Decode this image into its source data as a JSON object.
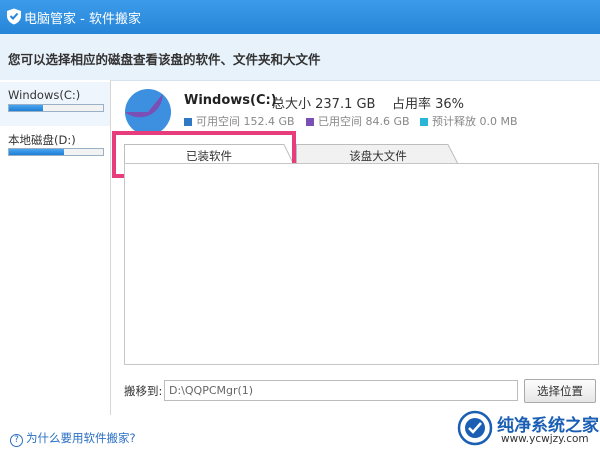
{
  "titlebar": {
    "title": "电脑管家 - 软件搬家",
    "icon": "shield-icon"
  },
  "header": {
    "text": "您可以选择相应的磁盘查看该盘的软件、文件夹和大文件"
  },
  "sidebar": {
    "drives": [
      {
        "name": "Windows(C:)",
        "usage_fraction": 0.36,
        "selected": true
      },
      {
        "name": "本地磁盘(D:)",
        "usage_fraction": 0.58,
        "selected": false
      }
    ]
  },
  "drive_info": {
    "title": "Windows(C:)",
    "total": "总大小 237.1 GB",
    "usage": "占用率 36%",
    "legend": [
      {
        "label": "可用空间 152.4 GB",
        "color": "#2f78c4"
      },
      {
        "label": "已用空间 84.6 GB",
        "color": "#7b4fb3"
      },
      {
        "label": "预计释放 0.0 MB",
        "color": "#29b5d6"
      }
    ],
    "pie": {
      "used_fraction": 0.36,
      "free_color": "#3d8fe0",
      "used_color": "#7b4fb3"
    }
  },
  "tabs": [
    {
      "label": "已装软件",
      "active": true
    },
    {
      "label": "该盘大文件",
      "active": false
    }
  ],
  "move": {
    "label": "搬移到:",
    "path": "D:\\QQPCMgr(1)",
    "button": "选择位置"
  },
  "help": {
    "text": "为什么要用软件搬家?"
  },
  "watermark": {
    "name": "纯净系统之家",
    "url": "www.ycwjzy.com"
  },
  "colors": {
    "accent": "#2785d8",
    "highlight": "#e83d7c"
  }
}
